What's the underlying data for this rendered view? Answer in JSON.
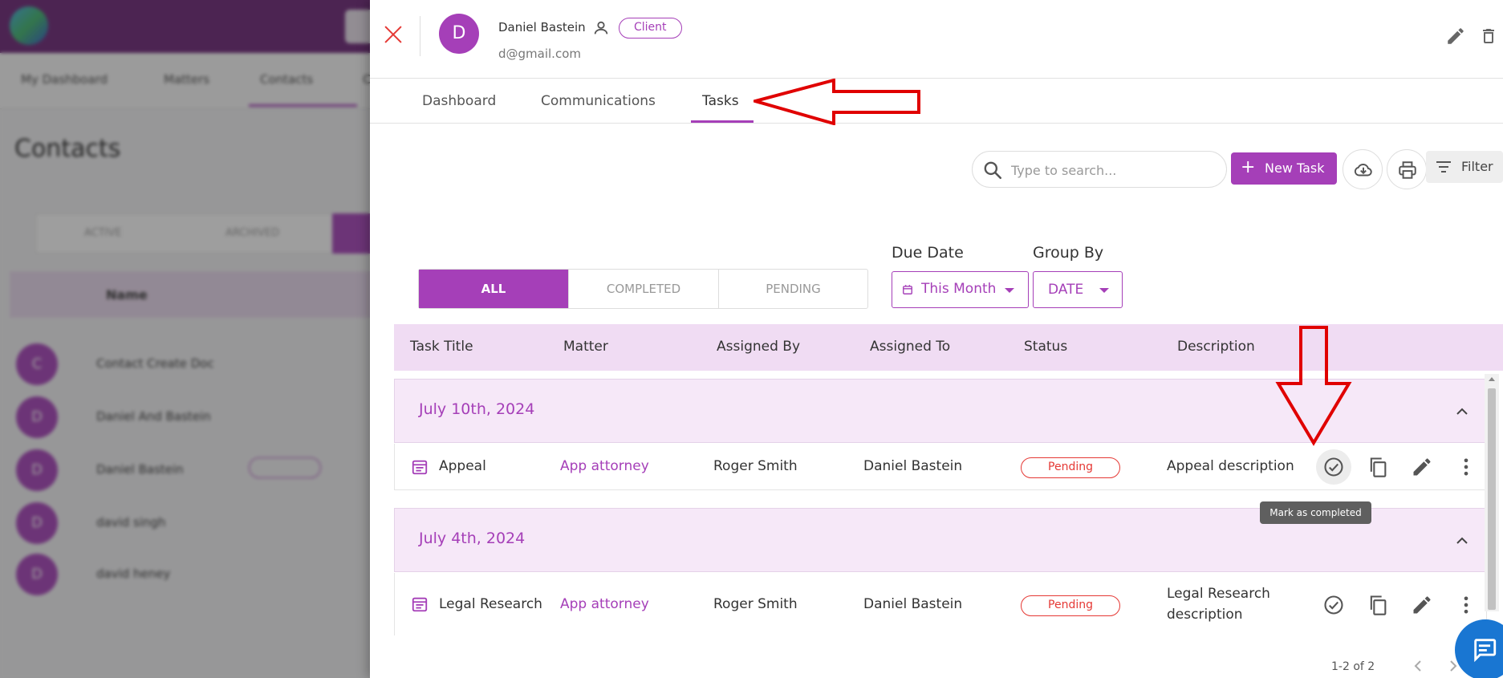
{
  "background": {
    "nav_items": [
      "My Dashboard",
      "Matters",
      "Contacts",
      "C"
    ],
    "page_title": "Contacts",
    "tabs": [
      "ACTIVE",
      "ARCHIVED"
    ],
    "table_header": "Name",
    "rows": [
      {
        "initial": "C",
        "name": "Contact Create Doc"
      },
      {
        "initial": "D",
        "name": "Daniel And Bastein"
      },
      {
        "initial": "D",
        "name": "Daniel Bastein"
      },
      {
        "initial": "D",
        "name": "david singh"
      },
      {
        "initial": "D",
        "name": "david heney"
      }
    ]
  },
  "drawer": {
    "avatar_initial": "D",
    "name": "Daniel Bastein",
    "role_pill": "Client",
    "email": "d@gmail.com",
    "tabs": [
      "Dashboard",
      "Communications",
      "Tasks"
    ],
    "active_tab": "Tasks"
  },
  "toolbar": {
    "search_placeholder": "Type to search...",
    "new_task_label": "New Task",
    "filter_label": "Filter"
  },
  "segmented": {
    "options": [
      "ALL",
      "COMPLETED",
      "PENDING"
    ],
    "active": "ALL"
  },
  "filters": {
    "due_date_label": "Due Date",
    "due_date_value": "This Month",
    "group_by_label": "Group By",
    "group_by_value": "DATE"
  },
  "table": {
    "columns": [
      "Task Title",
      "Matter",
      "Assigned By",
      "Assigned To",
      "Status",
      "Description"
    ],
    "groups": [
      {
        "date": "July 10th, 2024",
        "tasks": [
          {
            "title": "Appeal",
            "matter": "App attorney",
            "assigned_by": "Roger Smith",
            "assigned_to": "Daniel Bastein",
            "status": "Pending",
            "description": "Appeal description"
          }
        ]
      },
      {
        "date": "July 4th, 2024",
        "tasks": [
          {
            "title": "Legal Research",
            "matter": "App attorney",
            "assigned_by": "Roger Smith",
            "assigned_to": "Daniel Bastein",
            "status": "Pending",
            "description_line1": "Legal Research",
            "description_line2": "description"
          }
        ]
      }
    ]
  },
  "tooltip": "Mark as completed",
  "pager": "1-2 of 2",
  "colors": {
    "accent": "#a53fb8",
    "danger": "#e53935",
    "annotation": "#e00000",
    "chat": "#1976d2"
  }
}
